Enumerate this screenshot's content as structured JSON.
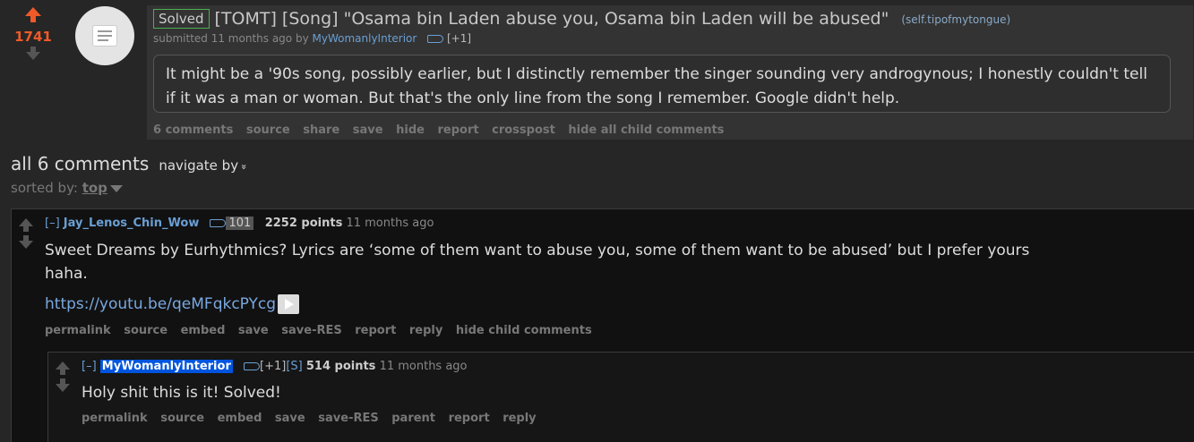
{
  "post": {
    "score": "1741",
    "flair": "Solved",
    "title": "[TOMT] [Song] \"Osama bin Laden abuse you, Osama bin Laden will be abused\"",
    "domain": "(self.tipofmytongue)",
    "tagline_prefix": "submitted 11 months ago by",
    "author": "MyWomanlyInterior",
    "author_tag": "[+1]",
    "selftext": "It might be a '90s song, possibly earlier, but I distinctly remember the singer sounding very androgynous; I honestly couldn't tell if it was a man or woman. But that's the only line from the song I remember. Google didn't help.",
    "buttons": [
      "6 comments",
      "source",
      "share",
      "save",
      "hide",
      "report",
      "crosspost",
      "hide all child comments"
    ]
  },
  "comments_header": {
    "title": "all 6 comments",
    "navigate": "navigate by",
    "navigate_chevron": "»",
    "sorted_label": "sorted by:",
    "sorted_value": "top"
  },
  "comments": [
    {
      "toggle": "[–]",
      "author": "Jay_Lenos_Chin_Wow",
      "tag_count": "101",
      "points": "2252 points",
      "time": "11 months ago",
      "body_text": "Sweet Dreams by Eurhythmics? Lyrics are ‘some of them want to abuse you, some of them want to be abused’ but I prefer yours haha.",
      "link": "https://youtu.be/qeMFqkcPYcg",
      "buttons": [
        "permalink",
        "source",
        "embed",
        "save",
        "save-RES",
        "report",
        "reply",
        "hide child comments"
      ]
    },
    {
      "toggle": "[–]",
      "author": "MyWomanlyInterior",
      "tag_plus": "[+1]",
      "tag_s": "[S]",
      "points": "514 points",
      "time": "11 months ago",
      "body_text": "Holy shit this is it! Solved!",
      "buttons": [
        "permalink",
        "source",
        "embed",
        "save",
        "save-RES",
        "parent",
        "report",
        "reply"
      ]
    }
  ],
  "colors": {
    "upvote": "#f05a28",
    "op_highlight": "#0055df",
    "link": "#7aa8e0",
    "solved_border": "#4caf50"
  },
  "icons": [
    "upvote-arrow-icon",
    "downvote-arrow-icon",
    "self-post-thumbnail-icon",
    "user-tag-icon",
    "play-video-icon",
    "sort-dropdown-icon"
  ]
}
